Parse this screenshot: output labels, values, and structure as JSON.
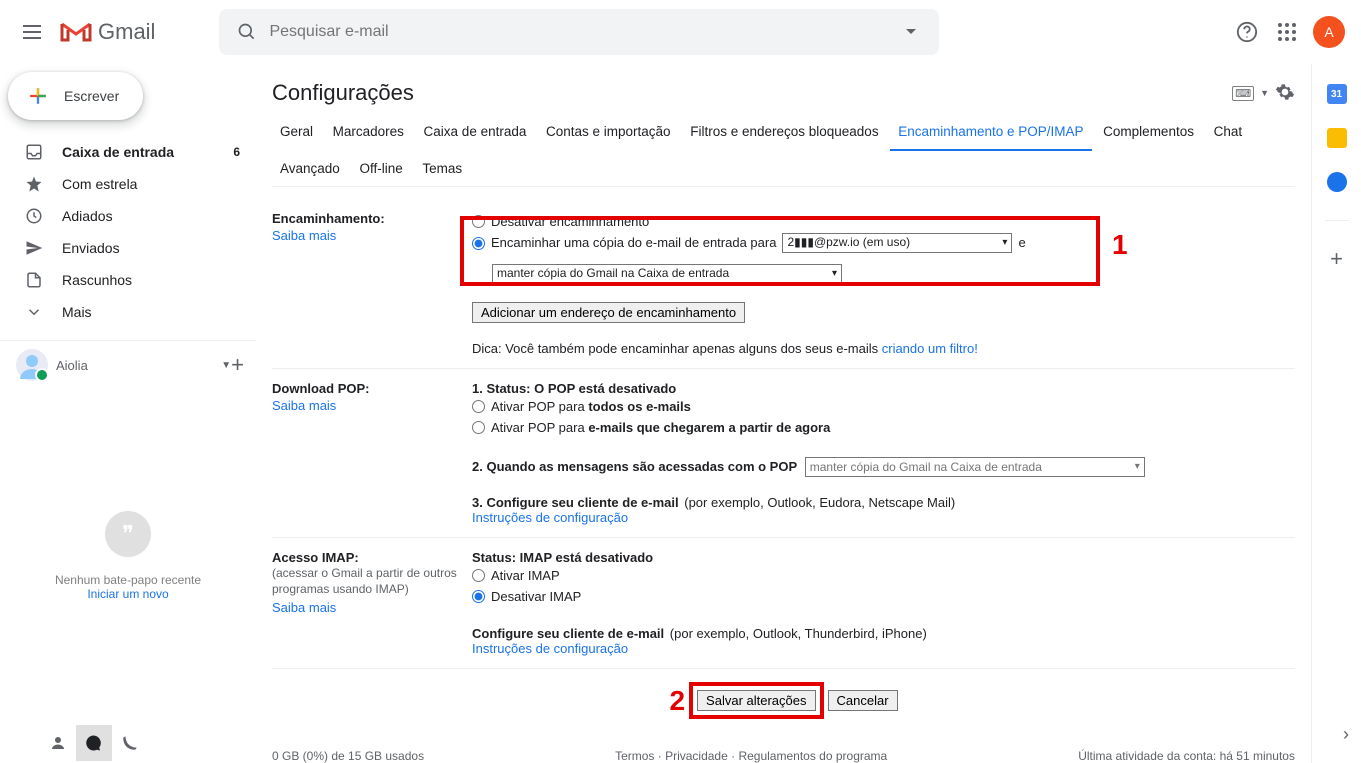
{
  "header": {
    "brand": "Gmail",
    "search_placeholder": "Pesquisar e-mail",
    "avatar_initial": "A"
  },
  "compose_label": "Escrever",
  "nav": [
    {
      "id": "inbox",
      "label": "Caixa de entrada",
      "count": "6",
      "active": true
    },
    {
      "id": "starred",
      "label": "Com estrela"
    },
    {
      "id": "snoozed",
      "label": "Adiados"
    },
    {
      "id": "sent",
      "label": "Enviados"
    },
    {
      "id": "drafts",
      "label": "Rascunhos"
    },
    {
      "id": "more",
      "label": "Mais"
    }
  ],
  "hangouts": {
    "user_name": "Aiolia",
    "no_chat": "Nenhum bate-papo recente",
    "start_new": "Iniciar um novo"
  },
  "page_title": "Configurações",
  "tabs": [
    "Geral",
    "Marcadores",
    "Caixa de entrada",
    "Contas e importação",
    "Filtros e endereços bloqueados",
    "Encaminhamento e POP/IMAP",
    "Complementos",
    "Chat",
    "Avançado",
    "Off-line",
    "Temas"
  ],
  "active_tab": "Encaminhamento e POP/IMAP",
  "forwarding": {
    "heading": "Encaminhamento:",
    "learn_more": "Saiba mais",
    "disable_label": "Desativar encaminhamento",
    "enable_label": "Encaminhar uma cópia do e-mail de entrada para",
    "email_select": "2▮▮▮@pzw.io (em uso)",
    "and_word": "e",
    "keep_select": "manter cópia do Gmail na Caixa de entrada",
    "add_btn": "Adicionar um endereço de encaminhamento",
    "tip_prefix": "Dica: Você também pode encaminhar apenas alguns dos seus e-mails ",
    "tip_link": "criando um filtro!"
  },
  "pop": {
    "heading": "Download POP:",
    "learn_more": "Saiba mais",
    "status": "1. Status: O POP está desativado",
    "enable_all_prefix": "Ativar POP para ",
    "enable_all_bold": "todos os e-mails",
    "enable_new_prefix": "Ativar POP para ",
    "enable_new_bold": "e-mails que chegarem a partir de agora",
    "when": "2. Quando as mensagens são acessadas com o POP",
    "when_select": "manter cópia do Gmail na Caixa de entrada",
    "configure": "3. Configure seu cliente de e-mail",
    "configure_example": "(por exemplo, Outlook, Eudora, Netscape Mail)",
    "instructions": "Instruções de configuração"
  },
  "imap": {
    "heading": "Acesso IMAP:",
    "sub": "(acessar o Gmail a partir de outros programas usando IMAP)",
    "learn_more": "Saiba mais",
    "status": "Status: IMAP está desativado",
    "enable": "Ativar IMAP",
    "disable": "Desativar IMAP",
    "configure": "Configure seu cliente de e-mail",
    "configure_example": "(por exemplo, Outlook, Thunderbird, iPhone)",
    "instructions": "Instruções de configuração"
  },
  "buttons": {
    "save": "Salvar alterações",
    "cancel": "Cancelar"
  },
  "footer": {
    "storage": "0 GB (0%) de 15 GB usados",
    "terms": "Termos",
    "privacy": "Privacidade",
    "rules": "Regulamentos do programa",
    "activity": "Última atividade da conta: há 51 minutos"
  },
  "annotations": {
    "num1": "1",
    "num2": "2"
  }
}
